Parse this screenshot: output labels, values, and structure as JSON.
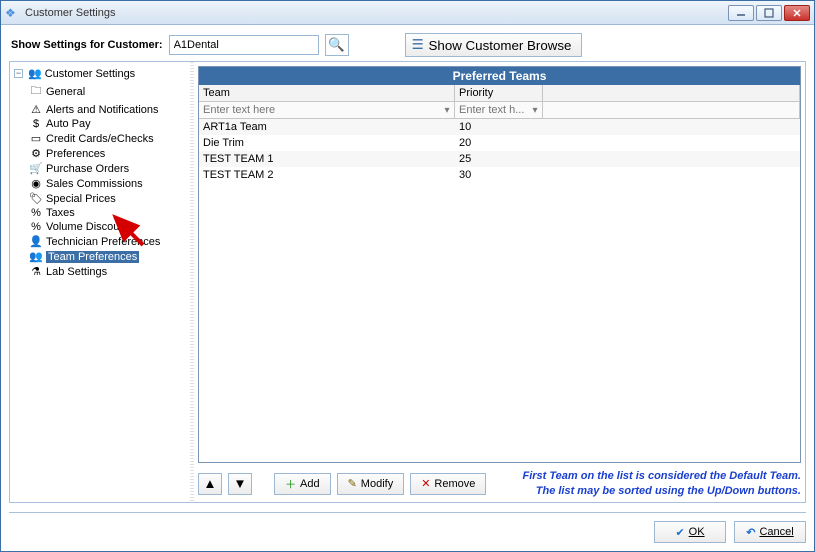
{
  "window": {
    "title": "Customer Settings"
  },
  "toolbar": {
    "label": "Show Settings for Customer:",
    "customer_value": "A1Dental",
    "browse_label": "Show Customer Browse"
  },
  "tree": {
    "root": "Customer Settings",
    "items": [
      {
        "icon": "folder-icon",
        "label": "General"
      },
      {
        "icon": "bell-icon",
        "label": "Alerts and Notifications"
      },
      {
        "icon": "money-icon",
        "label": "Auto Pay"
      },
      {
        "icon": "card-icon",
        "label": "Credit Cards/eChecks"
      },
      {
        "icon": "gear-icon",
        "label": "Preferences"
      },
      {
        "icon": "cart-icon",
        "label": "Purchase Orders"
      },
      {
        "icon": "coins-icon",
        "label": "Sales Commissions"
      },
      {
        "icon": "tag-icon",
        "label": "Special Prices"
      },
      {
        "icon": "percent-icon",
        "label": "Taxes"
      },
      {
        "icon": "percent-icon",
        "label": "Volume Discount"
      },
      {
        "icon": "person-icon",
        "label": "Technician Preferences"
      },
      {
        "icon": "team-icon",
        "label": "Team Preferences",
        "selected": true
      },
      {
        "icon": "flask-icon",
        "label": "Lab Settings"
      }
    ]
  },
  "grid": {
    "title": "Preferred Teams",
    "columns": {
      "team": "Team",
      "priority": "Priority"
    },
    "filter_placeholder": {
      "team": "Enter text here",
      "priority": "Enter text h..."
    },
    "rows": [
      {
        "team": "ART1a Team",
        "priority": "10"
      },
      {
        "team": "Die Trim",
        "priority": "20"
      },
      {
        "team": "TEST TEAM 1",
        "priority": "25"
      },
      {
        "team": "TEST TEAM 2",
        "priority": "30"
      }
    ]
  },
  "contentTools": {
    "add": "Add",
    "modify": "Modify",
    "remove": "Remove",
    "hint_line1": "First Team on the list is considered the Default Team.",
    "hint_line2": "The list may be sorted using the Up/Down buttons."
  },
  "footer": {
    "ok": "OK",
    "cancel": "Cancel"
  },
  "icons": {
    "search": "🔍",
    "list": "☰",
    "check": "✔",
    "undo": "↶",
    "add": "＋",
    "modify": "✎",
    "remove": "✕",
    "up": "▲",
    "down": "▼",
    "funnel": "⌕",
    "folder": "🗀",
    "bell": "⚠",
    "money": "$",
    "card": "▭",
    "gear": "⚙",
    "cart": "🛒",
    "coins": "◉",
    "tag": "🏷",
    "percent": "%",
    "person": "👤",
    "team": "👥",
    "flask": "⚗",
    "app": "❖"
  }
}
